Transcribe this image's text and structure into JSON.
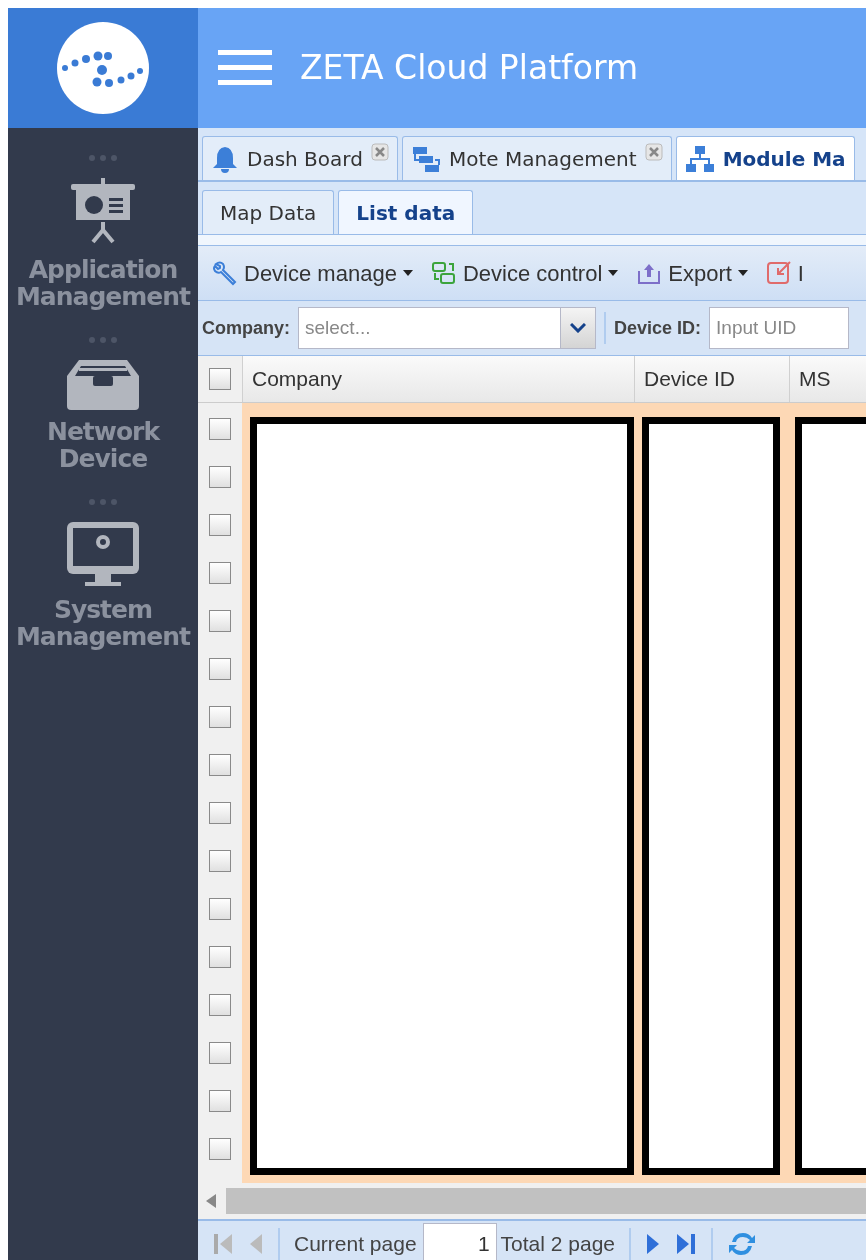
{
  "header": {
    "title": "ZETA Cloud Platform"
  },
  "sidebar": {
    "items": [
      {
        "label": "Application Management"
      },
      {
        "label": "Network Device"
      },
      {
        "label": "System Management"
      }
    ]
  },
  "tabs": [
    {
      "label": "Dash Board",
      "closable": true,
      "selected": false
    },
    {
      "label": "Mote Management",
      "closable": true,
      "selected": false
    },
    {
      "label": "Module Ma",
      "closable": false,
      "selected": true
    }
  ],
  "subtabs": [
    {
      "label": "Map Data",
      "selected": false
    },
    {
      "label": "List data",
      "selected": true
    }
  ],
  "toolbar": [
    {
      "label": "Device manage"
    },
    {
      "label": "Device control"
    },
    {
      "label": "Export"
    },
    {
      "label": "I"
    }
  ],
  "filters": [
    {
      "label": "Company:",
      "placeholder": "select...",
      "kind": "combo"
    },
    {
      "label": "Device ID:",
      "placeholder": "Input UID",
      "kind": "text"
    }
  ],
  "table": {
    "columns": [
      "Company",
      "Device ID",
      "MS"
    ],
    "all_checked": false,
    "rows": [
      {
        "checked": false
      },
      {
        "checked": false
      },
      {
        "checked": false
      },
      {
        "checked": false
      },
      {
        "checked": false
      },
      {
        "checked": false
      },
      {
        "checked": false
      },
      {
        "checked": false
      },
      {
        "checked": false
      },
      {
        "checked": false
      },
      {
        "checked": false
      },
      {
        "checked": false
      },
      {
        "checked": false
      },
      {
        "checked": false
      },
      {
        "checked": false
      },
      {
        "checked": false
      }
    ]
  },
  "pager": {
    "current_label": "Current page",
    "page": "1",
    "total": "Total 2 page"
  }
}
